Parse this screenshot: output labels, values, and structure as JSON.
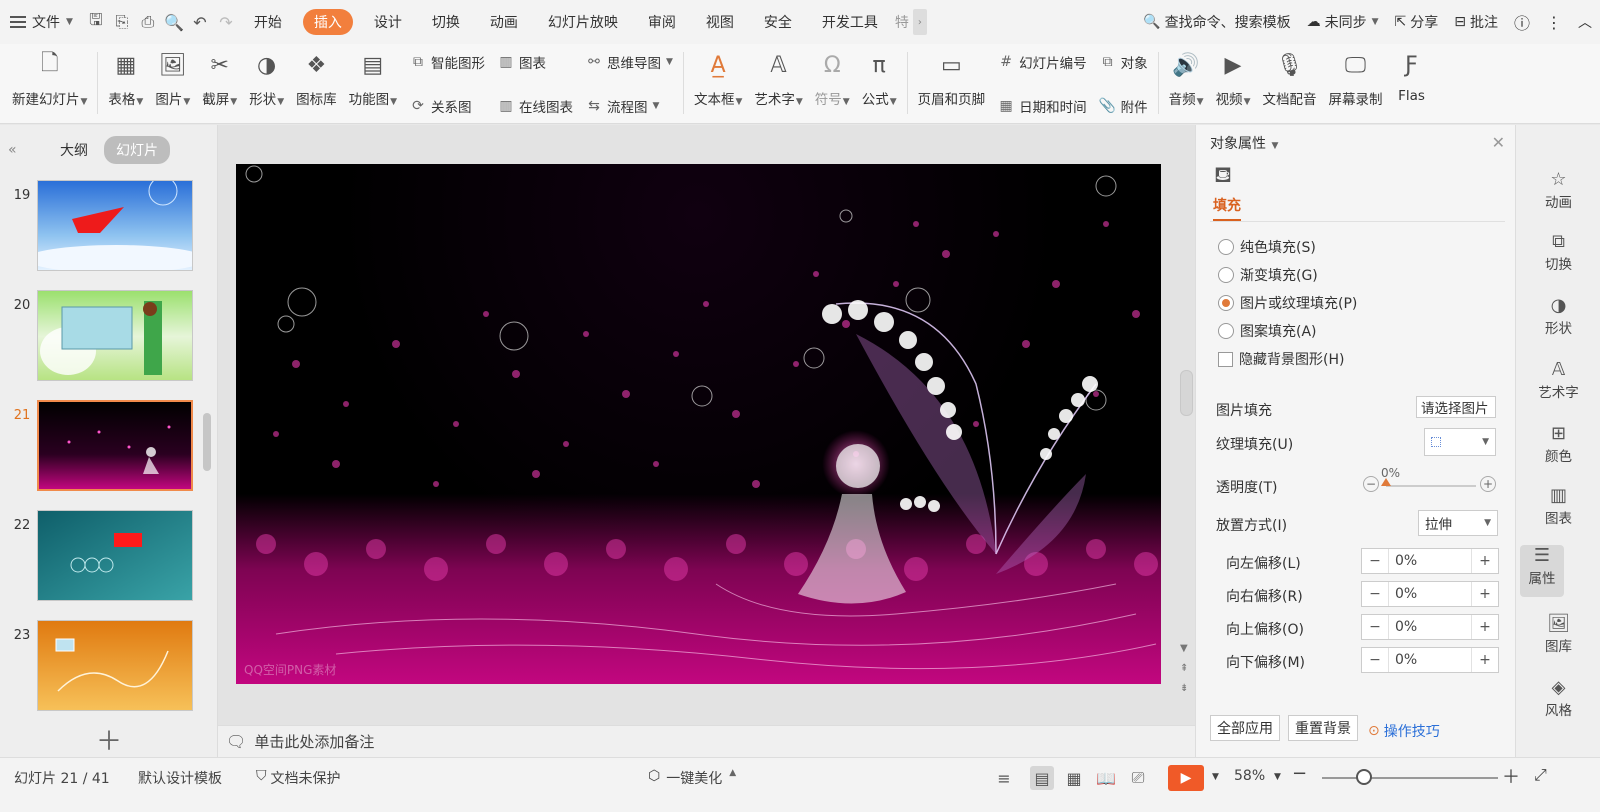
{
  "menubar": {
    "file_label": "文件",
    "tabs": [
      "开始",
      "插入",
      "设计",
      "切换",
      "动画",
      "幻灯片放映",
      "审阅",
      "视图",
      "安全",
      "开发工具",
      "特"
    ],
    "active_tab": "插入",
    "search": "查找命令、搜索模板",
    "sync": "未同步",
    "share": "分享",
    "comment": "批注"
  },
  "ribbon": {
    "new_slide": "新建幻灯片",
    "table": "表格",
    "picture": "图片",
    "screenshot": "截屏",
    "shape": "形状",
    "icon_lib": "图标库",
    "function_chart": "功能图",
    "smart_art": "智能图形",
    "chart": "图表",
    "relation": "关系图",
    "online_chart": "在线图表",
    "mindmap": "思维导图",
    "flowchart": "流程图",
    "textbox": "文本框",
    "wordart": "艺术字",
    "symbol": "符号",
    "formula": "公式",
    "header_footer": "页眉和页脚",
    "slide_number": "幻灯片编号",
    "date_time": "日期和时间",
    "object": "对象",
    "attachment": "附件",
    "audio": "音频",
    "video": "视频",
    "doc_dubbing": "文档配音",
    "screen_record": "屏幕录制",
    "flash": "Flas"
  },
  "leftpanel": {
    "tab_outline": "大纲",
    "tab_slides": "幻灯片",
    "slides": [
      {
        "num": "19",
        "selected": false
      },
      {
        "num": "20",
        "selected": false
      },
      {
        "num": "21",
        "selected": true
      },
      {
        "num": "22",
        "selected": false
      },
      {
        "num": "23",
        "selected": false
      }
    ]
  },
  "slide": {
    "watermark": "QQ空间PNG素材"
  },
  "notes": {
    "placeholder": "单击此处添加备注"
  },
  "props": {
    "title": "对象属性",
    "fill_tab": "填充",
    "options": [
      {
        "label": "纯色填充(S)",
        "checked": false
      },
      {
        "label": "渐变填充(G)",
        "checked": false
      },
      {
        "label": "图片或纹理填充(P)",
        "checked": true
      },
      {
        "label": "图案填充(A)",
        "checked": false
      }
    ],
    "hide_bg": "隐藏背景图形(H)",
    "picture_fill_label": "图片填充",
    "picture_fill_value": "请选择图片",
    "texture_fill_label": "纹理填充(U)",
    "transparency_label": "透明度(T)",
    "transparency_value": "0%",
    "placement_label": "放置方式(I)",
    "placement_value": "拉伸",
    "offsets": [
      {
        "label": "向左偏移(L)",
        "value": "0%"
      },
      {
        "label": "向右偏移(R)",
        "value": "0%"
      },
      {
        "label": "向上偏移(O)",
        "value": "0%"
      },
      {
        "label": "向下偏移(M)",
        "value": "0%"
      }
    ],
    "apply_all": "全部应用",
    "reset_bg": "重置背景",
    "tips": "操作技巧"
  },
  "rstrip": [
    "动画",
    "切换",
    "形状",
    "艺术字",
    "颜色",
    "图表",
    "属性",
    "图库",
    "风格"
  ],
  "status": {
    "slide_pos": "幻灯片 21 / 41",
    "template": "默认设计模板",
    "protect": "文档未保护",
    "beautify": "一键美化",
    "zoom": "58%"
  },
  "colors": {
    "accent": "#f27f3d",
    "slide_magenta": "#c2067f",
    "play": "#f05a28"
  }
}
